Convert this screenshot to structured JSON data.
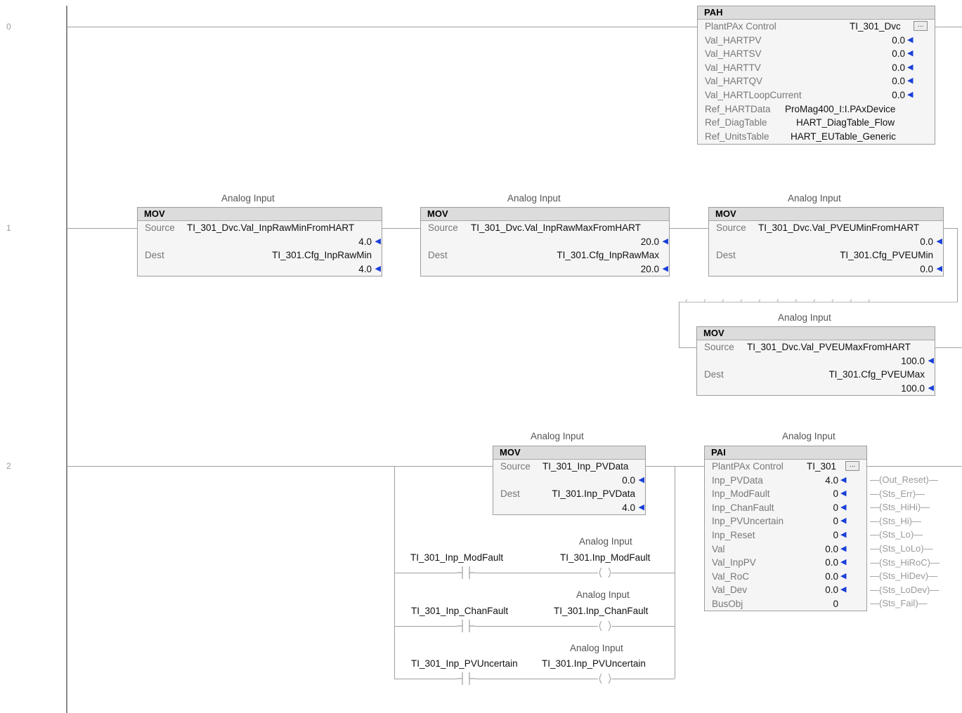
{
  "rungs": [
    "0",
    "1",
    "2"
  ],
  "rung0": {
    "pah": {
      "title": "PAH",
      "rows": [
        {
          "label": "PlantPAx Control",
          "value": "TI_301_Dvc"
        },
        {
          "label": "Val_HARTPV",
          "value": "0.0"
        },
        {
          "label": "Val_HARTSV",
          "value": "0.0"
        },
        {
          "label": "Val_HARTTV",
          "value": "0.0"
        },
        {
          "label": "Val_HARTQV",
          "value": "0.0"
        },
        {
          "label": "Val_HARTLoopCurrent",
          "value": "0.0"
        },
        {
          "label": "Ref_HARTData",
          "value": "ProMag400_I:I.PAxDevice"
        },
        {
          "label": "Ref_DiagTable",
          "value": "HART_DiagTable_Flow"
        },
        {
          "label": "Ref_UnitsTable",
          "value": "HART_EUTable_Generic"
        }
      ],
      "dots": "..."
    }
  },
  "rung1": {
    "mov1": {
      "caption": "Analog Input",
      "title": "MOV",
      "source_label": "Source",
      "source": "TI_301_Dvc.Val_InpRawMinFromHART",
      "source_val": "4.0",
      "dest_label": "Dest",
      "dest": "TI_301.Cfg_InpRawMin",
      "dest_val": "4.0"
    },
    "mov2": {
      "caption": "Analog Input",
      "title": "MOV",
      "source_label": "Source",
      "source": "TI_301_Dvc.Val_InpRawMaxFromHART",
      "source_val": "20.0",
      "dest_label": "Dest",
      "dest": "TI_301.Cfg_InpRawMax",
      "dest_val": "20.0"
    },
    "mov3": {
      "caption": "Analog Input",
      "title": "MOV",
      "source_label": "Source",
      "source": "TI_301_Dvc.Val_PVEUMinFromHART",
      "source_val": "0.0",
      "dest_label": "Dest",
      "dest": "TI_301.Cfg_PVEUMin",
      "dest_val": "0.0"
    },
    "mov4": {
      "caption": "Analog Input",
      "title": "MOV",
      "source_label": "Source",
      "source": "TI_301_Dvc.Val_PVEUMaxFromHART",
      "source_val": "100.0",
      "dest_label": "Dest",
      "dest": "TI_301.Cfg_PVEUMax",
      "dest_val": "100.0"
    }
  },
  "rung2": {
    "mov5": {
      "caption": "Analog Input",
      "title": "MOV",
      "source_label": "Source",
      "source": "TI_301_Inp_PVData",
      "source_val": "0.0",
      "dest_label": "Dest",
      "dest": "TI_301.Inp_PVData",
      "dest_val": "4.0"
    },
    "branches": [
      {
        "contact": "TI_301_Inp_ModFault",
        "caption": "Analog Input",
        "coil": "TI_301.Inp_ModFault"
      },
      {
        "contact": "TI_301_Inp_ChanFault",
        "caption": "Analog Input",
        "coil": "TI_301.Inp_ChanFault"
      },
      {
        "contact": "TI_301_Inp_PVUncertain",
        "caption": "Analog Input",
        "coil": "TI_301.Inp_PVUncertain"
      }
    ],
    "pai": {
      "caption": "Analog Input",
      "title": "PAI",
      "control_label": "PlantPAx Control",
      "control_value": "TI_301",
      "dots": "...",
      "rows": [
        {
          "label": "Inp_PVData",
          "value": "4.0"
        },
        {
          "label": "Inp_ModFault",
          "value": "0"
        },
        {
          "label": "Inp_ChanFault",
          "value": "0"
        },
        {
          "label": "Inp_PVUncertain",
          "value": "0"
        },
        {
          "label": "Inp_Reset",
          "value": "0"
        },
        {
          "label": "Val",
          "value": "0.0"
        },
        {
          "label": "Val_InpPV",
          "value": "0.0"
        },
        {
          "label": "Val_RoC",
          "value": "0.0"
        },
        {
          "label": "Val_Dev",
          "value": "0.0"
        },
        {
          "label": "BusObj",
          "value": "0"
        }
      ],
      "outputs": [
        "Out_Reset",
        "Sts_Err",
        "Sts_HiHi",
        "Sts_Hi",
        "Sts_Lo",
        "Sts_LoLo",
        "Sts_HiRoC",
        "Sts_HiDev",
        "Sts_LoDev",
        "Sts_Fail"
      ]
    }
  },
  "colors": {
    "arrow": "#1a3fd8",
    "block_head": "#dcdcdc",
    "block_body": "#f5f5f5",
    "wire": "#a0a0a0"
  }
}
